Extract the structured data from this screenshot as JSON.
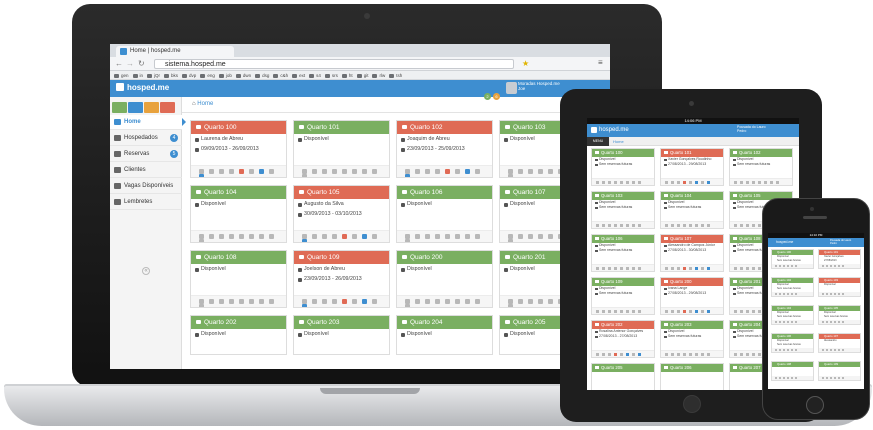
{
  "browser": {
    "tab_title": "Home | hosped.me",
    "url": "sistema.hosped.me",
    "bookmarks": [
      "gen",
      "in",
      "jQr",
      "bks",
      "dvp",
      "eng",
      "job",
      "dwn",
      "dsg",
      "c&h",
      "ext",
      "s4",
      "srs",
      "ht",
      "git",
      "rlw",
      "tsh"
    ]
  },
  "app": {
    "logo": "hosped.me",
    "user_name": "Moradas Hosped.me",
    "user_sub": "Joe",
    "header_badges": [
      "2",
      "6"
    ]
  },
  "sidebar": {
    "items": [
      {
        "label": "Home",
        "icon": "home-icon",
        "count": ""
      },
      {
        "label": "Hospedados",
        "icon": "key-icon",
        "count": "4"
      },
      {
        "label": "Reservas",
        "icon": "book-icon",
        "count": "5"
      },
      {
        "label": "Clientes",
        "icon": "users-icon",
        "count": ""
      },
      {
        "label": "Vagas Disponíveis",
        "icon": "bed-icon",
        "count": ""
      },
      {
        "label": "Lembretes",
        "icon": "envelope-icon",
        "count": ""
      }
    ],
    "collapse_glyph": "«"
  },
  "breadcrumb": "Home",
  "rooms": [
    {
      "title": "Quarto 100",
      "status": "red",
      "line1": "Laurena de Abreu",
      "line2": "09/09/2013 - 26/09/2013"
    },
    {
      "title": "Quarto 101",
      "status": "green",
      "line1": "Disponível",
      "line2": ""
    },
    {
      "title": "Quarto 102",
      "status": "red",
      "line1": "Joaquim de Abreu",
      "line2": "23/09/2013 - 25/09/2013"
    },
    {
      "title": "Quarto 103",
      "status": "green",
      "line1": "Disponível",
      "line2": ""
    },
    {
      "title": "Quarto 104",
      "status": "green",
      "line1": "Disponível",
      "line2": ""
    },
    {
      "title": "Quarto 105",
      "status": "red",
      "line1": "Augusto da Silva",
      "line2": "30/09/2013 - 03/10/2013"
    },
    {
      "title": "Quarto 106",
      "status": "green",
      "line1": "Disponível",
      "line2": ""
    },
    {
      "title": "Quarto 107",
      "status": "green",
      "line1": "Disponível",
      "line2": ""
    },
    {
      "title": "Quarto 108",
      "status": "green",
      "line1": "Disponível",
      "line2": ""
    },
    {
      "title": "Quarto 109",
      "status": "red",
      "line1": "Joelson de Abreu",
      "line2": "23/09/2013 - 26/09/2013"
    },
    {
      "title": "Quarto 200",
      "status": "green",
      "line1": "Disponível",
      "line2": ""
    },
    {
      "title": "Quarto 201",
      "status": "green",
      "line1": "Disponível",
      "line2": ""
    },
    {
      "title": "Quarto 202",
      "status": "green",
      "line1": "Disponível",
      "line2": ""
    },
    {
      "title": "Quarto 203",
      "status": "green",
      "line1": "Disponível",
      "line2": ""
    },
    {
      "title": "Quarto 204",
      "status": "green",
      "line1": "Disponível",
      "line2": ""
    },
    {
      "title": "Quarto 205",
      "status": "green",
      "line1": "Disponível",
      "line2": ""
    }
  ],
  "tablet": {
    "time": "14:06 PM",
    "logo": "hosped.me",
    "user": "Pousada do Lauro",
    "user_sub": "Pedro",
    "menu": "MENU",
    "crumb": "Home",
    "rooms": [
      {
        "title": "Quarto 100",
        "status": "green",
        "line1": "Disponível",
        "line2": "Sem reservas futuras"
      },
      {
        "title": "Quarto 101",
        "status": "red",
        "line1": "Xavier Gonçalves Roudinho",
        "line2": "27/08/2013 - 29/08/2013"
      },
      {
        "title": "Quarto 102",
        "status": "green",
        "line1": "Disponível",
        "line2": "Sem reservas futuras"
      },
      {
        "title": "Quarto 103",
        "status": "green",
        "line1": "Disponível",
        "line2": "Sem reservas futuras"
      },
      {
        "title": "Quarto 104",
        "status": "green",
        "line1": "Disponível",
        "line2": "Sem reservas futuras"
      },
      {
        "title": "Quarto 105",
        "status": "green",
        "line1": "Disponível",
        "line2": "Sem reservas futuras"
      },
      {
        "title": "Quarto 106",
        "status": "green",
        "line1": "Disponível",
        "line2": "Sem reservas futuras"
      },
      {
        "title": "Quarto 107",
        "status": "red",
        "line1": "Alessandro de Campos Júnior",
        "line2": "27/08/2013 - 30/08/2013"
      },
      {
        "title": "Quarto 108",
        "status": "green",
        "line1": "Disponível",
        "line2": "Sem reservas futuras"
      },
      {
        "title": "Quarto 109",
        "status": "green",
        "line1": "Disponível",
        "line2": "Sem reservas futuras"
      },
      {
        "title": "Quarto 200",
        "status": "red",
        "line1": "Ivana Lange",
        "line2": "27/08/2013 - 29/08/2013"
      },
      {
        "title": "Quarto 201",
        "status": "green",
        "line1": "Disponível",
        "line2": "Sem reservas futuras"
      },
      {
        "title": "Quarto 202",
        "status": "red",
        "line1": "Rosalina Antenor Gonçalves",
        "line2": "27/08/2013 - 27/08/2013"
      },
      {
        "title": "Quarto 203",
        "status": "green",
        "line1": "Disponível",
        "line2": "Sem reservas futuras"
      },
      {
        "title": "Quarto 204",
        "status": "green",
        "line1": "Disponível",
        "line2": "Sem reservas futuras"
      },
      {
        "title": "Quarto 205",
        "status": "green",
        "line1": "",
        "line2": ""
      },
      {
        "title": "Quarto 206",
        "status": "green",
        "line1": "",
        "line2": ""
      },
      {
        "title": "Quarto 207",
        "status": "green",
        "line1": "",
        "line2": ""
      }
    ]
  },
  "phone": {
    "time": "14:10 PM",
    "logo": "hosped.me",
    "user": "Pousada do Lauro",
    "user_sub": "Pedro",
    "rooms": [
      {
        "title": "Quarto 100",
        "status": "green",
        "line1": "Disponível",
        "line2": "Sem reservas futuras"
      },
      {
        "title": "Quarto 101",
        "status": "red",
        "line1": "Xavier Gonçalves",
        "line2": "27/08/2013"
      },
      {
        "title": "Quarto 102",
        "status": "green",
        "line1": "Disponível",
        "line2": "Sem reservas futuras"
      },
      {
        "title": "Quarto 103",
        "status": "red",
        "line1": "Disponível",
        "line2": ""
      },
      {
        "title": "Quarto 104",
        "status": "green",
        "line1": "Disponível",
        "line2": "Sem reservas futuras"
      },
      {
        "title": "Quarto 105",
        "status": "green",
        "line1": "Disponível",
        "line2": "Sem reservas futuras"
      },
      {
        "title": "Quarto 106",
        "status": "green",
        "line1": "Disponível",
        "line2": "Sem reservas futuras"
      },
      {
        "title": "Quarto 107",
        "status": "red",
        "line1": "Alessandro",
        "line2": ""
      },
      {
        "title": "Quarto 108",
        "status": "green",
        "line1": "",
        "line2": ""
      },
      {
        "title": "Quarto 109",
        "status": "green",
        "line1": "",
        "line2": ""
      }
    ]
  },
  "colors": {
    "primary": "#3e8ed0",
    "available": "#7aaf61",
    "occupied": "#df6b55"
  }
}
